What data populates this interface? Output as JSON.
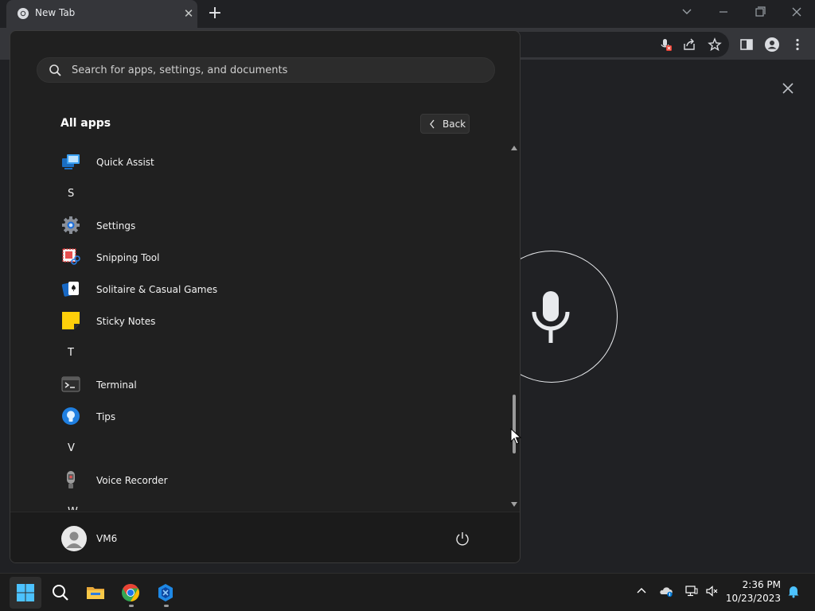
{
  "browser": {
    "tab_title": "New Tab",
    "new_tab_symbol": "+"
  },
  "start_menu": {
    "search_placeholder": "Search for apps, settings, and documents",
    "all_apps_title": "All apps",
    "back_label": "Back",
    "items": [
      {
        "kind": "app",
        "name": "Quick Assist",
        "icon": "quick-assist-icon"
      },
      {
        "kind": "letter",
        "name": "S"
      },
      {
        "kind": "app",
        "name": "Settings",
        "icon": "settings-gear-icon"
      },
      {
        "kind": "app",
        "name": "Snipping Tool",
        "icon": "snipping-tool-icon"
      },
      {
        "kind": "app",
        "name": "Solitaire & Casual Games",
        "icon": "solitaire-cards-icon"
      },
      {
        "kind": "app",
        "name": "Sticky Notes",
        "icon": "sticky-notes-icon"
      },
      {
        "kind": "letter",
        "name": "T"
      },
      {
        "kind": "app",
        "name": "Terminal",
        "icon": "terminal-icon"
      },
      {
        "kind": "app",
        "name": "Tips",
        "icon": "tips-lightbulb-icon"
      },
      {
        "kind": "letter",
        "name": "V"
      },
      {
        "kind": "app",
        "name": "Voice Recorder",
        "icon": "voice-recorder-icon"
      },
      {
        "kind": "letter",
        "name": "W"
      }
    ],
    "user_name": "VM6"
  },
  "taskbar": {
    "time": "2:36 PM",
    "date": "10/23/2023"
  },
  "colors": {
    "start_bg": "#202020",
    "accent_blue": "#0078d4",
    "chrome_bg": "#202124"
  }
}
